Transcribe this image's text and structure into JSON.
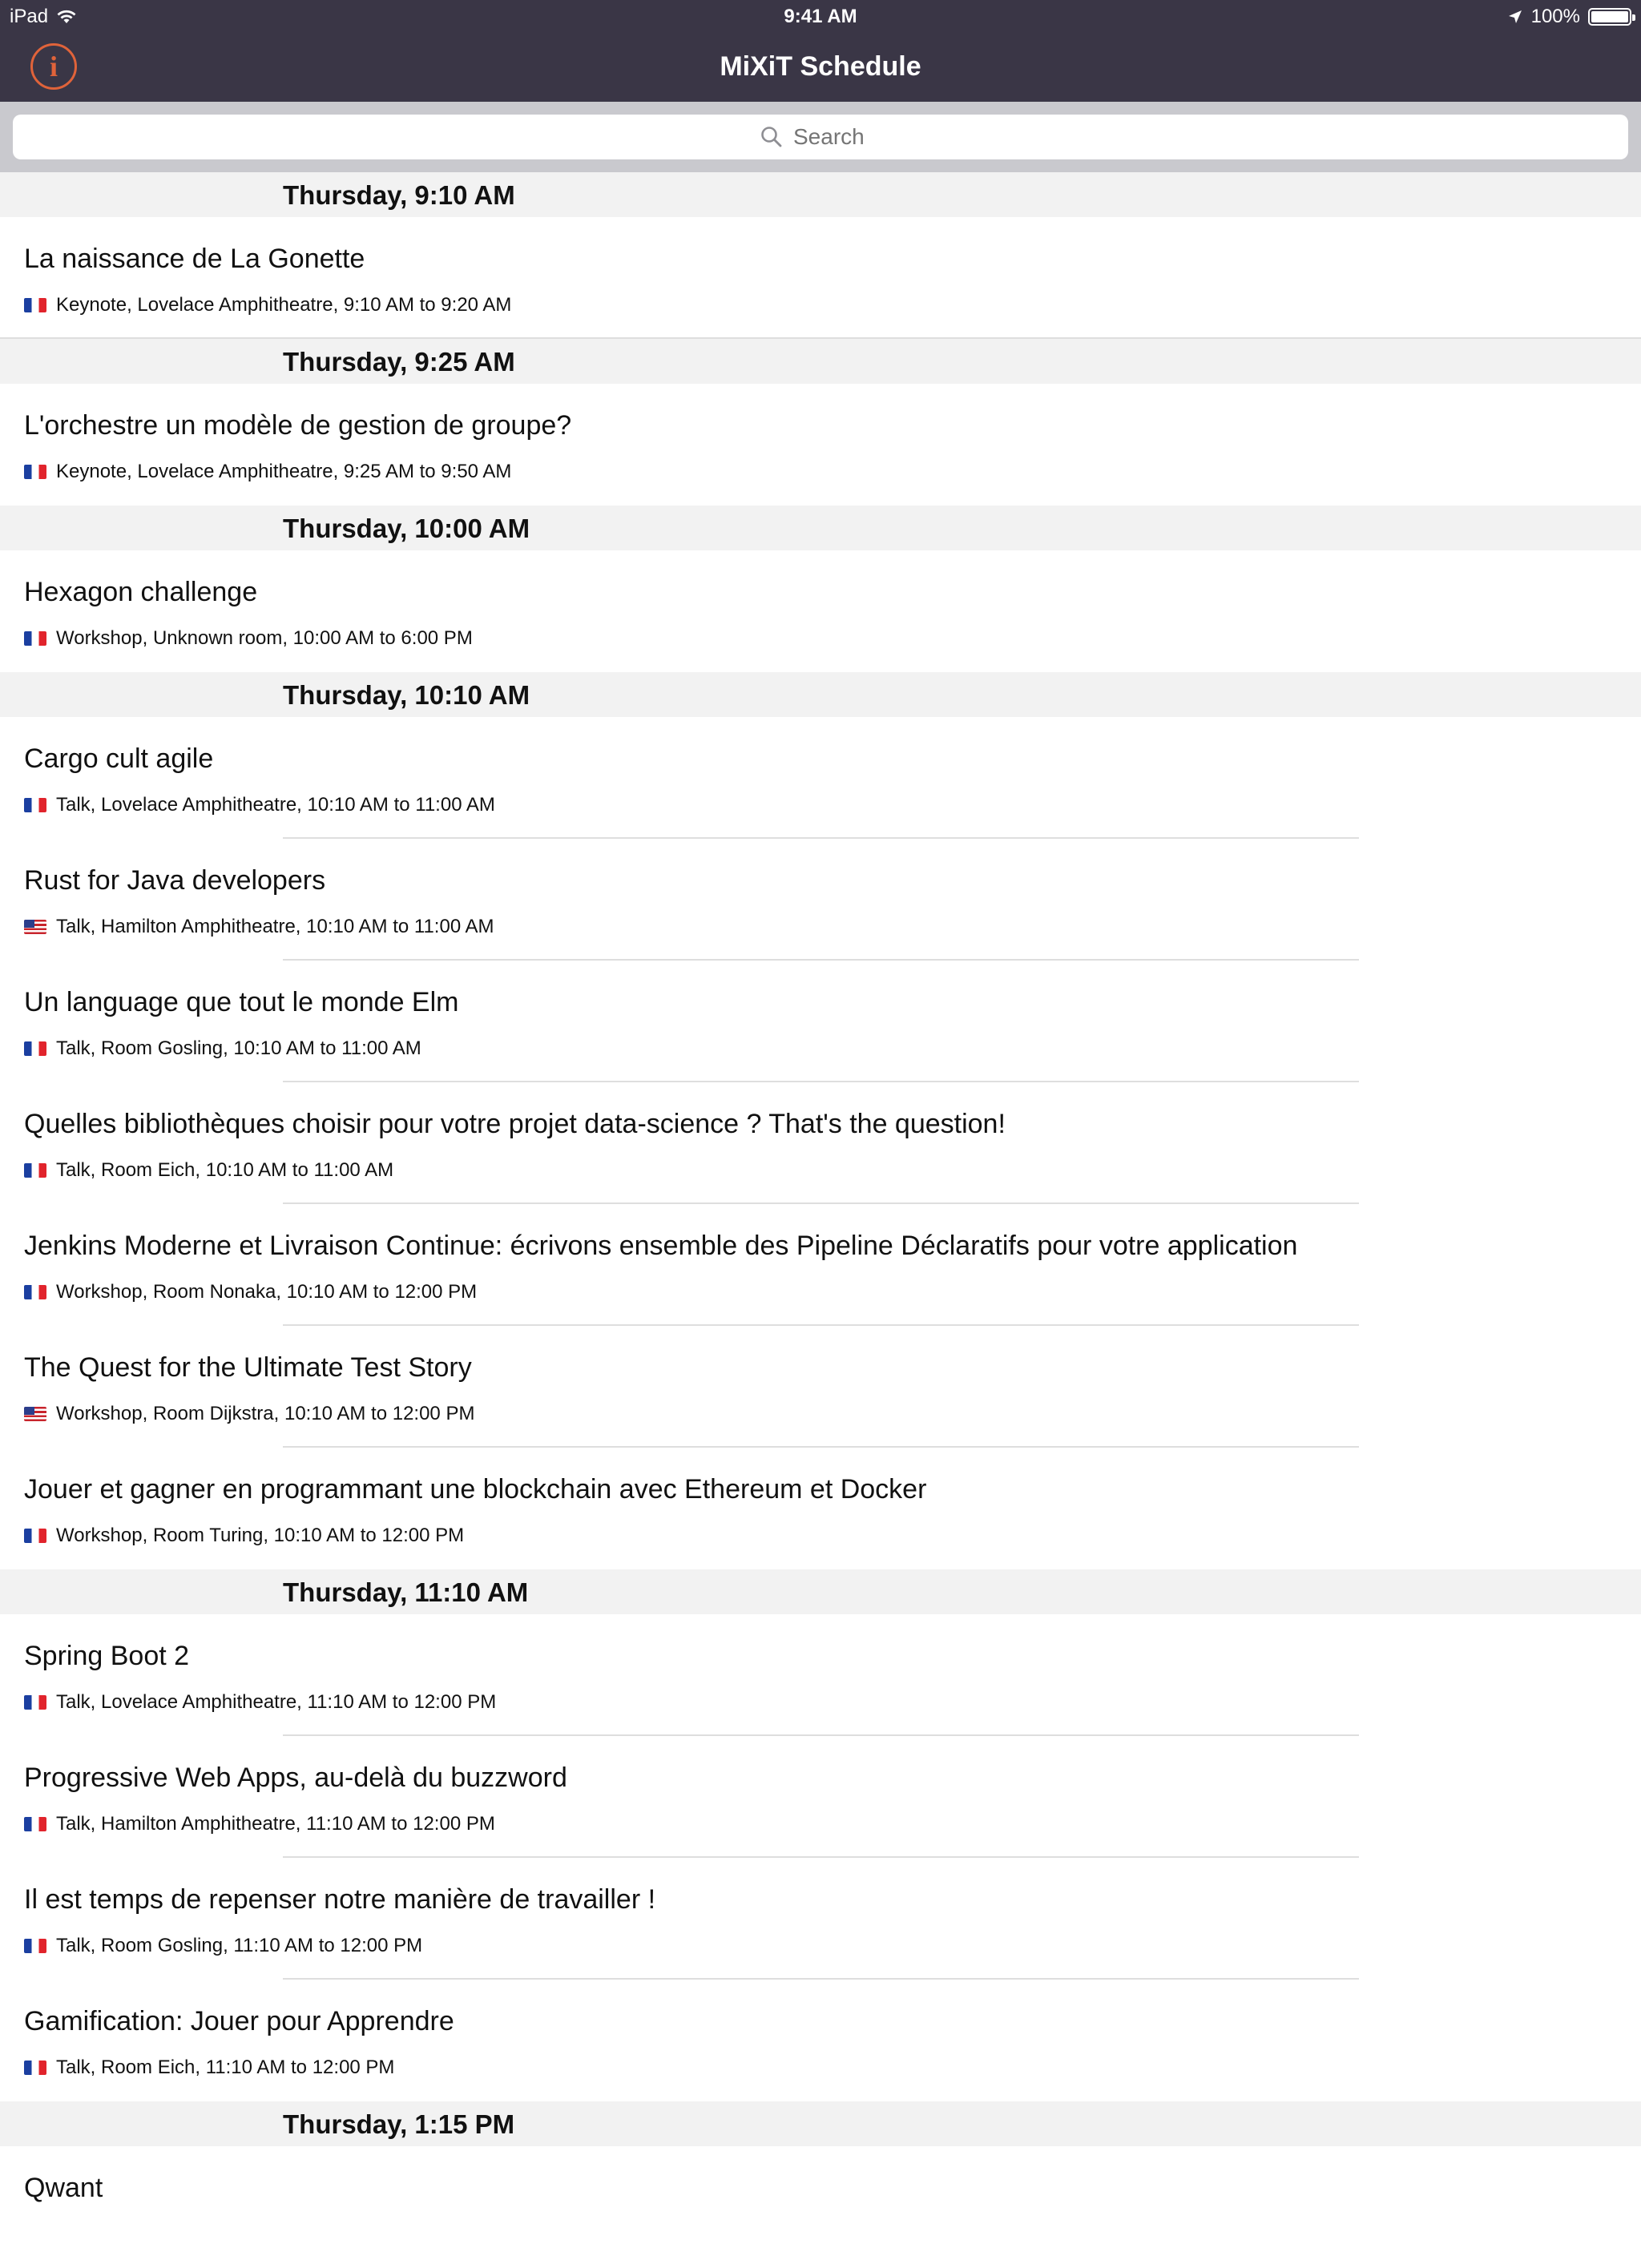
{
  "status_bar": {
    "device": "iPad",
    "time": "9:41 AM",
    "battery": "100%"
  },
  "nav": {
    "title": "MiXiT Schedule"
  },
  "search": {
    "placeholder": "Search"
  },
  "sections": [
    {
      "header": "Thursday, 9:10 AM",
      "sessions": [
        {
          "title": "La naissance de La Gonette",
          "flag": "fr",
          "meta": "Keynote, Lovelace Amphitheatre, 9:10 AM to 9:20 AM"
        }
      ]
    },
    {
      "header": "Thursday, 9:25 AM",
      "sessions": [
        {
          "title": "L'orchestre un modèle de gestion de groupe?",
          "flag": "fr",
          "meta": "Keynote, Lovelace Amphitheatre, 9:25 AM to 9:50 AM"
        }
      ]
    },
    {
      "header": "Thursday, 10:00 AM",
      "sessions": [
        {
          "title": "Hexagon challenge",
          "flag": "fr",
          "meta": "Workshop, Unknown room, 10:00 AM to 6:00 PM"
        }
      ]
    },
    {
      "header": "Thursday, 10:10 AM",
      "sessions": [
        {
          "title": "Cargo cult agile",
          "flag": "fr",
          "meta": "Talk, Lovelace Amphitheatre, 10:10 AM to 11:00 AM"
        },
        {
          "title": "Rust for Java developers",
          "flag": "us",
          "meta": "Talk, Hamilton Amphitheatre, 10:10 AM to 11:00 AM"
        },
        {
          "title": "Un language que tout le monde Elm",
          "flag": "fr",
          "meta": "Talk, Room Gosling, 10:10 AM to 11:00 AM"
        },
        {
          "title": "Quelles bibliothèques choisir pour votre projet data-science ? That's the question!",
          "flag": "fr",
          "meta": "Talk, Room Eich, 10:10 AM to 11:00 AM"
        },
        {
          "title": "Jenkins Moderne et Livraison Continue: écrivons ensemble des Pipeline Déclaratifs pour votre application",
          "flag": "fr",
          "meta": "Workshop, Room Nonaka, 10:10 AM to 12:00 PM"
        },
        {
          "title": "The Quest for the Ultimate Test Story",
          "flag": "us",
          "meta": "Workshop, Room Dijkstra, 10:10 AM to 12:00 PM"
        },
        {
          "title": "Jouer et gagner en programmant une blockchain avec Ethereum et Docker",
          "flag": "fr",
          "meta": "Workshop, Room Turing, 10:10 AM to 12:00 PM"
        }
      ]
    },
    {
      "header": "Thursday, 11:10 AM",
      "sessions": [
        {
          "title": "Spring Boot 2",
          "flag": "fr",
          "meta": "Talk, Lovelace Amphitheatre, 11:10 AM to 12:00 PM"
        },
        {
          "title": "Progressive Web Apps, au-delà du buzzword",
          "flag": "fr",
          "meta": "Talk, Hamilton Amphitheatre, 11:10 AM to 12:00 PM"
        },
        {
          "title": "Il est temps de repenser notre manière de travailler !",
          "flag": "fr",
          "meta": "Talk, Room Gosling, 11:10 AM to 12:00 PM"
        },
        {
          "title": "Gamification: Jouer pour Apprendre",
          "flag": "fr",
          "meta": "Talk, Room Eich, 11:10 AM to 12:00 PM"
        }
      ]
    },
    {
      "header": "Thursday, 1:15 PM",
      "sessions": [
        {
          "title": "Qwant",
          "flag": "fr",
          "meta": ""
        }
      ]
    }
  ]
}
